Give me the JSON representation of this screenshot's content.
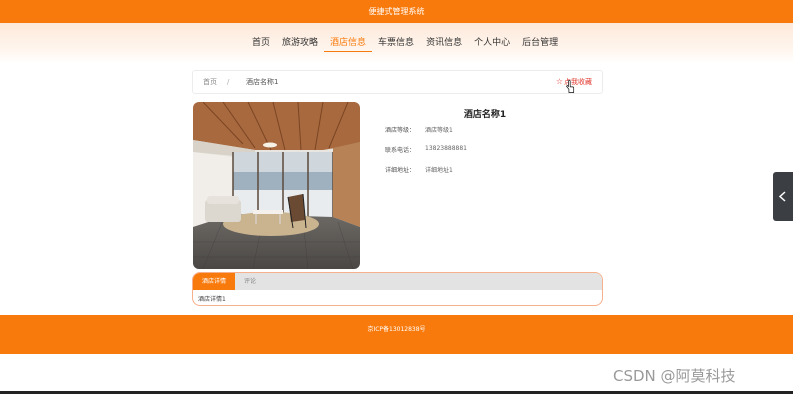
{
  "header": {
    "title": "便捷式管理系统"
  },
  "nav": {
    "items": [
      {
        "label": "首页"
      },
      {
        "label": "旅游攻略"
      },
      {
        "label": "酒店信息"
      },
      {
        "label": "车票信息"
      },
      {
        "label": "资讯信息"
      },
      {
        "label": "个人中心"
      },
      {
        "label": "后台管理"
      }
    ],
    "active_index": 2
  },
  "breadcrumb": {
    "home": "首页",
    "separator": "/",
    "current": "酒店名称1"
  },
  "favorite": {
    "label": "点我收藏",
    "icon": "star-outline-icon"
  },
  "hotel": {
    "name": "酒店名称1",
    "fields": [
      {
        "label": "酒店等级：",
        "value": "酒店等级1"
      },
      {
        "label": "联系电话：",
        "value": "13823888881"
      },
      {
        "label": "详细地址：",
        "value": "详细地址1"
      }
    ]
  },
  "tabs": [
    {
      "label": "酒店详情"
    },
    {
      "label": "评论"
    }
  ],
  "tab_content": "酒店详情1",
  "footer": {
    "text": "京ICP备13012838号"
  },
  "side_button": {
    "icon": "chevron-left-icon"
  },
  "watermark": "CSDN @阿莫科技",
  "colors": {
    "accent": "#f97a0c",
    "favorite": "#e03a2f",
    "side_button": "#3b3f43"
  }
}
